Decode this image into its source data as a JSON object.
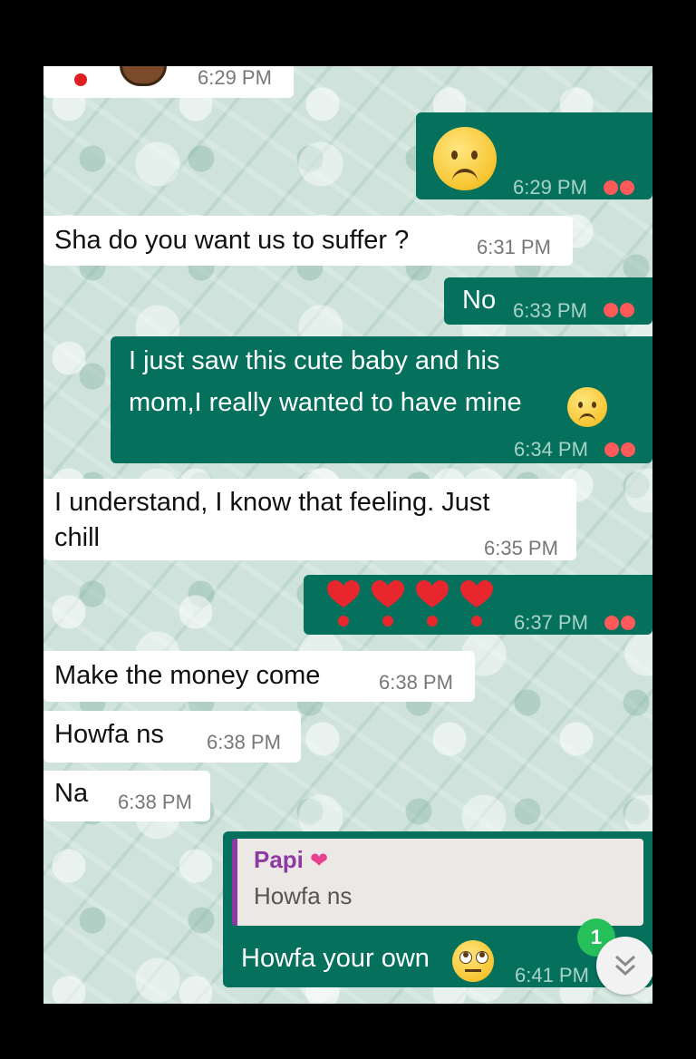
{
  "messages": [
    {
      "dir": "in",
      "text": "",
      "time": "6:29 PM"
    },
    {
      "dir": "out",
      "text": "",
      "time": "6:29 PM",
      "emoji": "worried-face"
    },
    {
      "dir": "in",
      "text": "Sha do you want us to suffer ?",
      "time": "6:31 PM"
    },
    {
      "dir": "out",
      "text": "No",
      "time": "6:33 PM"
    },
    {
      "dir": "out",
      "line1": "I just saw this cute baby and his",
      "line2": "mom,I really wanted to have mine",
      "time": "6:34 PM",
      "emoji": "worried-face"
    },
    {
      "dir": "in",
      "line1": "I understand, I know that feeling. Just",
      "line2": "chill",
      "time": "6:35 PM"
    },
    {
      "dir": "out",
      "text": "",
      "time": "6:37 PM",
      "emoji": "heart-exclamation x4"
    },
    {
      "dir": "in",
      "text": "Make the money come",
      "time": "6:38 PM"
    },
    {
      "dir": "in",
      "text": "Howfa ns",
      "time": "6:38 PM"
    },
    {
      "dir": "in",
      "text": "Na",
      "time": "6:38 PM"
    },
    {
      "dir": "out",
      "text": "Howfa your own",
      "time": "6:41 PM",
      "emoji": "eye-roll-face",
      "quote": {
        "author": "Papi",
        "author_emoji": "heart-with-ribbon",
        "text": "Howfa ns"
      }
    }
  ],
  "unread_badge": "1",
  "colors": {
    "outgoing": "#05705c",
    "incoming": "#ffffff",
    "read_ticks": "#ff5a5a",
    "badge": "#25c05a",
    "quote_author": "#8e3aa3"
  }
}
